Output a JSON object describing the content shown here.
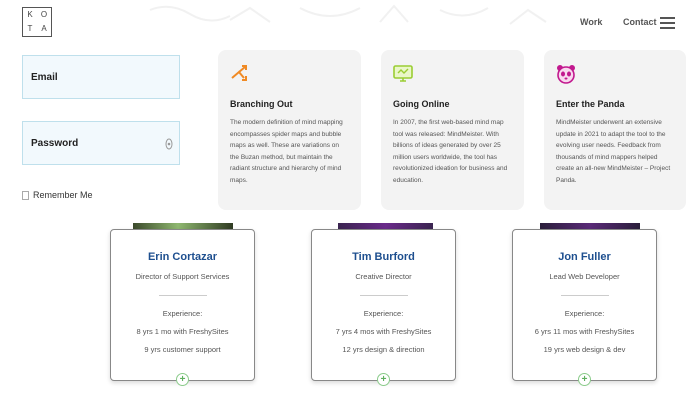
{
  "header": {
    "logo_letters": [
      "K",
      "O",
      "T",
      "A"
    ],
    "nav": {
      "work": "Work",
      "contact": "Contact"
    }
  },
  "form": {
    "email_placeholder": "Email",
    "password_placeholder": "Password",
    "remember_label": "Remember Me"
  },
  "timeline": [
    {
      "title": "Branching Out",
      "icon": "branch-arrows-icon",
      "body": "The modern definition of mind mapping encompasses spider maps and bubble maps as well. These are variations on the Buzan method, but maintain the radiant structure and hierarchy of mind maps."
    },
    {
      "title": "Going Online",
      "icon": "monitor-icon",
      "body": "In 2007, the first web-based mind map tool was released: MindMeister. With billions of ideas generated by over 25 million users worldwide, the tool has revolutionized ideation for business and education."
    },
    {
      "title": "Enter the Panda",
      "icon": "panda-icon",
      "body": "MindMeister underwent an extensive update in 2021 to adapt the tool to the evolving user needs. Feedback from thousands of mind mappers helped create an all-new MindMeister – Project Panda."
    }
  ],
  "team": [
    {
      "name": "Erin Cortazar",
      "role": "Director of Support Services",
      "experience_label": "Experience:",
      "exp1": "8 yrs 1 mo with FreshySites",
      "exp2": "9 yrs customer support"
    },
    {
      "name": "Tim Burford",
      "role": "Creative Director",
      "experience_label": "Experience:",
      "exp1": "7 yrs 4 mos with FreshySites",
      "exp2": "12 yrs design & direction"
    },
    {
      "name": "Jon Fuller",
      "role": "Lead Web Developer",
      "experience_label": "Experience:",
      "exp1": "6 yrs 11 mos with FreshySites",
      "exp2": "19 yrs web design & dev"
    }
  ],
  "colors": {
    "name_blue": "#1e4f8f",
    "plus_green": "#5fb05f",
    "field_bg": "#f2f9fd",
    "card_bg": "#f3f3f3"
  }
}
